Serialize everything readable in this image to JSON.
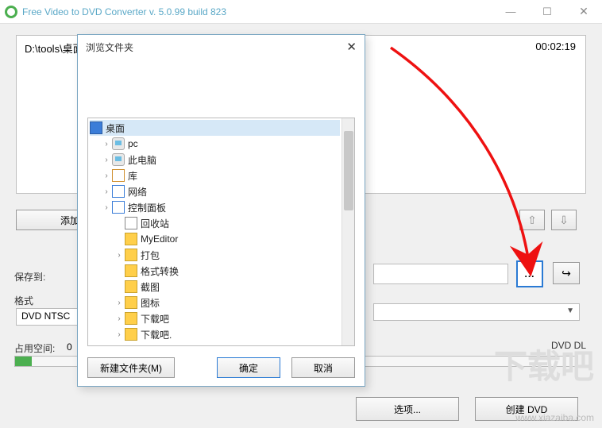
{
  "titlebar": {
    "title": "Free Video to DVD Converter  v. 5.0.99 build 823"
  },
  "preview": {
    "path": "D:\\tools\\桌面",
    "time": "00:02:19"
  },
  "buttons": {
    "add": "添加",
    "browse": "...",
    "options": "选项...",
    "create": "创建 DVD"
  },
  "labels": {
    "saveTo": "保存到:",
    "format": "格式",
    "space": "占用空间:",
    "dvddl": "DVD DL"
  },
  "values": {
    "format": "DVD NTSC",
    "space": "0"
  },
  "dialog": {
    "title": "浏览文件夹",
    "buttons": {
      "newFolder": "新建文件夹(M)",
      "ok": "确定",
      "cancel": "取消"
    },
    "tree": {
      "root": "桌面",
      "items": [
        {
          "label": "pc",
          "icon": "pc",
          "exp": true
        },
        {
          "label": "此电脑",
          "icon": "pc",
          "exp": true
        },
        {
          "label": "库",
          "icon": "lib",
          "exp": true
        },
        {
          "label": "网络",
          "icon": "net",
          "exp": true
        },
        {
          "label": "控制面板",
          "icon": "cp",
          "exp": true
        },
        {
          "label": "回收站",
          "icon": "bin",
          "exp": false
        },
        {
          "label": "MyEditor",
          "icon": "folder",
          "exp": false
        },
        {
          "label": "打包",
          "icon": "folder",
          "exp": true
        },
        {
          "label": "格式转换",
          "icon": "folder",
          "exp": false
        },
        {
          "label": "截图",
          "icon": "folder",
          "exp": false
        },
        {
          "label": "图标",
          "icon": "folder",
          "exp": true
        },
        {
          "label": "下载吧",
          "icon": "folder",
          "exp": true
        },
        {
          "label": "下载吧.",
          "icon": "folder",
          "exp": true
        }
      ]
    }
  },
  "watermark": {
    "big": "下载吧",
    "url": "www.xiazaiba.com"
  }
}
